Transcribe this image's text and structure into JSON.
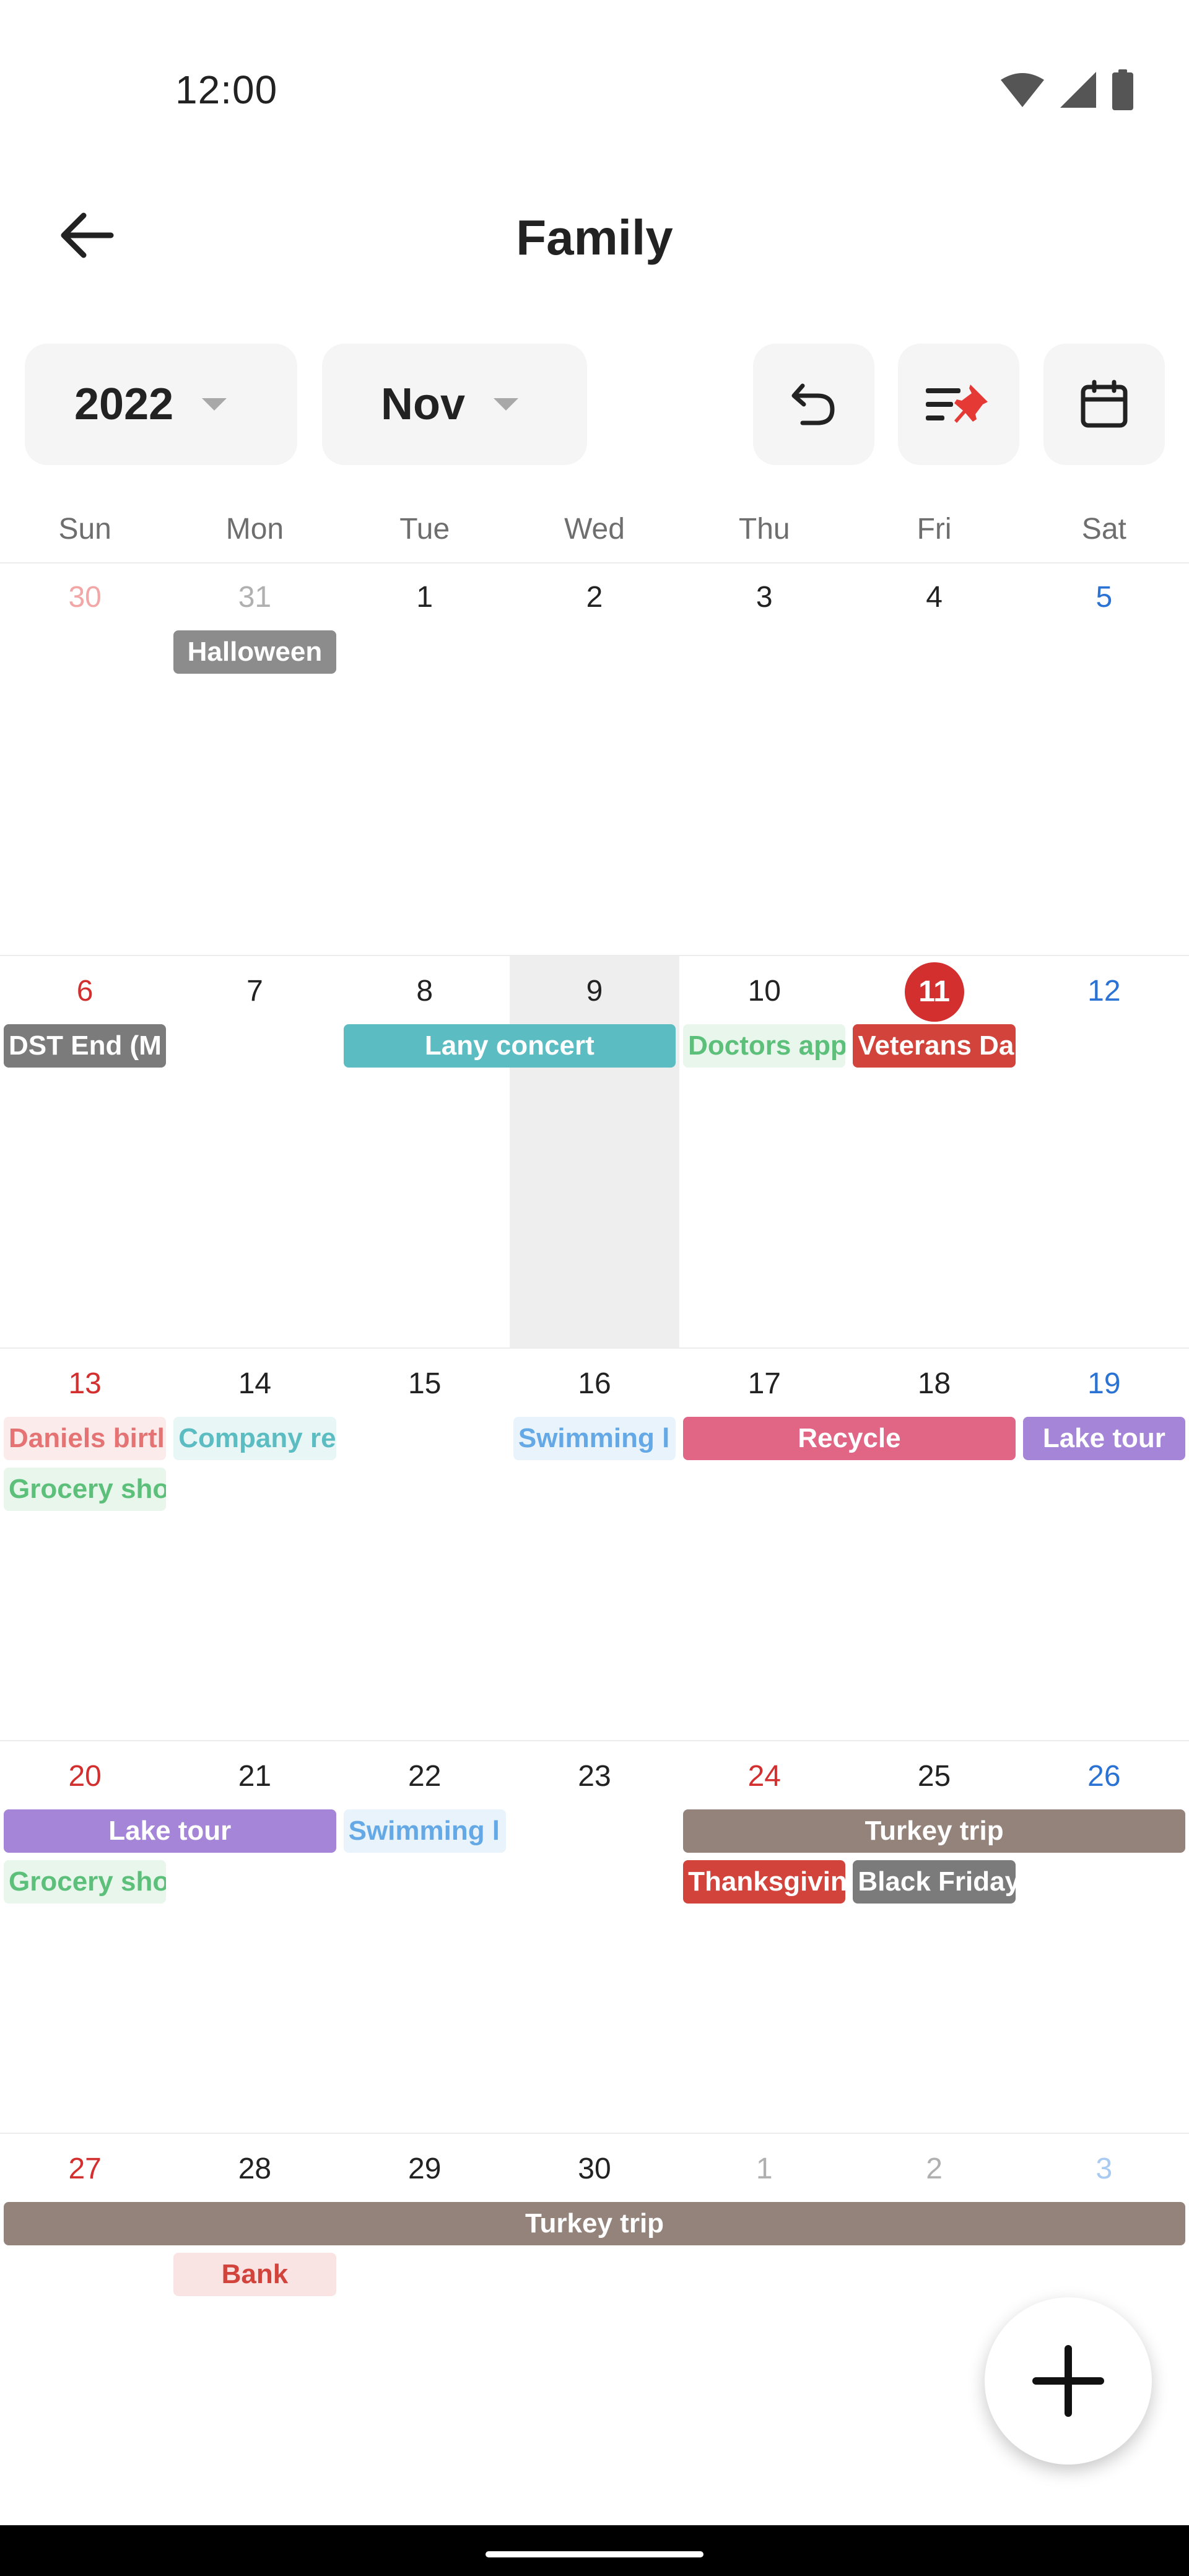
{
  "status_bar": {
    "time": "12:00",
    "icons": [
      "wifi-icon",
      "signal-icon",
      "battery-icon"
    ]
  },
  "app_bar": {
    "title": "Family",
    "back_icon": "arrow-left-icon"
  },
  "toolbar": {
    "year": "2022",
    "month": "Nov",
    "buttons": [
      "undo-icon",
      "sort-pin-icon",
      "calendar-icon"
    ]
  },
  "colors": {
    "today": "#d32f2f",
    "sunday": "#d32f2f",
    "saturday": "#2a72d4",
    "other_month_sunday": "#f2a6a6",
    "other_month_saturday": "#a9cbf2",
    "other_month": "#b0b0b0",
    "default_day": "#222222",
    "today_column": "#eeeeee"
  },
  "weekdays": [
    "Sun",
    "Mon",
    "Tue",
    "Wed",
    "Thu",
    "Fri",
    "Sat"
  ],
  "weeks": [
    {
      "days": [
        {
          "label": "30",
          "kind": "other-sun"
        },
        {
          "label": "31",
          "kind": "other"
        },
        {
          "label": "1",
          "kind": "normal"
        },
        {
          "label": "2",
          "kind": "normal"
        },
        {
          "label": "3",
          "kind": "normal"
        },
        {
          "label": "4",
          "kind": "normal"
        },
        {
          "label": "5",
          "kind": "sat"
        }
      ],
      "events": [
        {
          "title": "Halloween",
          "start": 1,
          "span": 1,
          "row": 0,
          "style": "solid",
          "color": "#8c8c8c",
          "align": "center"
        }
      ]
    },
    {
      "days": [
        {
          "label": "6",
          "kind": "sun"
        },
        {
          "label": "7",
          "kind": "normal"
        },
        {
          "label": "8",
          "kind": "normal"
        },
        {
          "label": "9",
          "kind": "normal",
          "highlight": true
        },
        {
          "label": "10",
          "kind": "normal"
        },
        {
          "label": "11",
          "kind": "today"
        },
        {
          "label": "12",
          "kind": "sat"
        }
      ],
      "events": [
        {
          "title": "DST End (M",
          "start": 0,
          "span": 1,
          "row": 0,
          "style": "solid",
          "color": "#7b7b7b",
          "align": "left"
        },
        {
          "title": "Lany concert",
          "start": 2,
          "span": 2,
          "row": 0,
          "style": "solid",
          "color": "#5bbcc2",
          "align": "center"
        },
        {
          "title": "Doctors app",
          "start": 4,
          "span": 1,
          "row": 0,
          "style": "tint",
          "color": "#5cbf7a",
          "align": "left"
        },
        {
          "title": "Veterans Da",
          "start": 5,
          "span": 1,
          "row": 0,
          "style": "solid",
          "color": "#d2433b",
          "align": "left"
        }
      ]
    },
    {
      "days": [
        {
          "label": "13",
          "kind": "sun"
        },
        {
          "label": "14",
          "kind": "normal"
        },
        {
          "label": "15",
          "kind": "normal"
        },
        {
          "label": "16",
          "kind": "normal"
        },
        {
          "label": "17",
          "kind": "normal"
        },
        {
          "label": "18",
          "kind": "normal"
        },
        {
          "label": "19",
          "kind": "sat"
        }
      ],
      "events": [
        {
          "title": "Daniels birtl",
          "start": 0,
          "span": 1,
          "row": 0,
          "style": "tint",
          "color": "#e57373",
          "align": "left"
        },
        {
          "title": "Company re",
          "start": 1,
          "span": 1,
          "row": 0,
          "style": "tint",
          "color": "#5bbcc2",
          "align": "left"
        },
        {
          "title": "Swimming l",
          "start": 3,
          "span": 1,
          "row": 0,
          "style": "tint",
          "color": "#64a9e6",
          "align": "left"
        },
        {
          "title": "Recycle",
          "start": 4,
          "span": 2,
          "row": 0,
          "style": "solid",
          "color": "#e16585",
          "align": "center"
        },
        {
          "title": "Lake tour",
          "start": 6,
          "span": 1,
          "row": 0,
          "style": "solid",
          "color": "#a585d8",
          "align": "center"
        },
        {
          "title": "Grocery sho",
          "start": 0,
          "span": 1,
          "row": 1,
          "style": "tint",
          "color": "#5cbf7a",
          "align": "left"
        }
      ]
    },
    {
      "days": [
        {
          "label": "20",
          "kind": "sun"
        },
        {
          "label": "21",
          "kind": "normal"
        },
        {
          "label": "22",
          "kind": "normal"
        },
        {
          "label": "23",
          "kind": "normal"
        },
        {
          "label": "24",
          "kind": "holiday"
        },
        {
          "label": "25",
          "kind": "normal"
        },
        {
          "label": "26",
          "kind": "sat"
        }
      ],
      "events": [
        {
          "title": "Lake tour",
          "start": 0,
          "span": 2,
          "row": 0,
          "style": "solid",
          "color": "#a585d8",
          "align": "center"
        },
        {
          "title": "Swimming l",
          "start": 2,
          "span": 1,
          "row": 0,
          "style": "tint",
          "color": "#64a9e6",
          "align": "left"
        },
        {
          "title": "Turkey trip",
          "start": 4,
          "span": 3,
          "row": 0,
          "style": "solid",
          "color": "#94837a",
          "align": "center"
        },
        {
          "title": "Grocery sho",
          "start": 0,
          "span": 1,
          "row": 1,
          "style": "tint",
          "color": "#5cbf7a",
          "align": "left"
        },
        {
          "title": "Thanksgivin",
          "start": 4,
          "span": 1,
          "row": 1,
          "style": "solid",
          "color": "#d2433b",
          "align": "left"
        },
        {
          "title": "Black Friday",
          "start": 5,
          "span": 1,
          "row": 1,
          "style": "solid",
          "color": "#7b7b7b",
          "align": "left"
        }
      ]
    },
    {
      "days": [
        {
          "label": "27",
          "kind": "sun"
        },
        {
          "label": "28",
          "kind": "normal"
        },
        {
          "label": "29",
          "kind": "normal"
        },
        {
          "label": "30",
          "kind": "normal"
        },
        {
          "label": "1",
          "kind": "other"
        },
        {
          "label": "2",
          "kind": "other"
        },
        {
          "label": "3",
          "kind": "other-sat"
        }
      ],
      "events": [
        {
          "title": "Turkey trip",
          "start": 0,
          "span": 7,
          "row": 0,
          "style": "solid",
          "color": "#94837a",
          "align": "center"
        },
        {
          "title": "Bank",
          "start": 1,
          "span": 1,
          "row": 1,
          "style": "tint",
          "color": "#d2433b",
          "align": "center"
        }
      ]
    }
  ],
  "fab": {
    "icon": "plus-icon"
  }
}
